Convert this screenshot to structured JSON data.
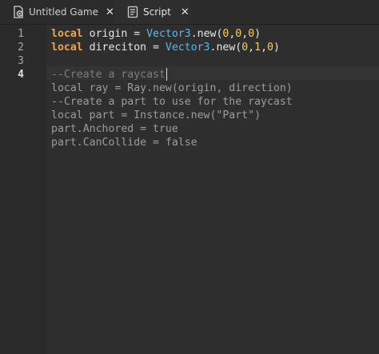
{
  "tabs": [
    {
      "label": "Untitled Game",
      "icon": "place-file-icon",
      "close": "✕"
    },
    {
      "label": "Script",
      "icon": "script-document-icon",
      "close": "✕"
    }
  ],
  "line_numbers": [
    "1",
    "2",
    "3",
    "4"
  ],
  "code": {
    "line1": {
      "keyword": "local",
      "name": " origin = ",
      "cls": "Vector3",
      "method": ".new(",
      "n1": "0",
      "c1": ",",
      "n2": "0",
      "c2": ",",
      "n3": "0",
      "close": ")"
    },
    "line2": {
      "keyword": "local",
      "name": " direciton = ",
      "cls": "Vector3",
      "method": ".new(",
      "n1": "0",
      "c1": ",",
      "n2": "1",
      "c2": ",",
      "n3": "0",
      "close": ")"
    },
    "line4": "--Create a raycast",
    "line5": "local ray = Ray.new(origin, direction)",
    "line6": "--Create a part to use for the raycast",
    "line7": "local part = Instance.new(\"Part\")",
    "line8": "part.Anchored = true",
    "line9": "part.CanCollide = false"
  },
  "colors": {
    "keyword": "#f4a343",
    "class": "#5eb7e8",
    "number": "#f5cd5e",
    "background": "#2e2e2e"
  }
}
